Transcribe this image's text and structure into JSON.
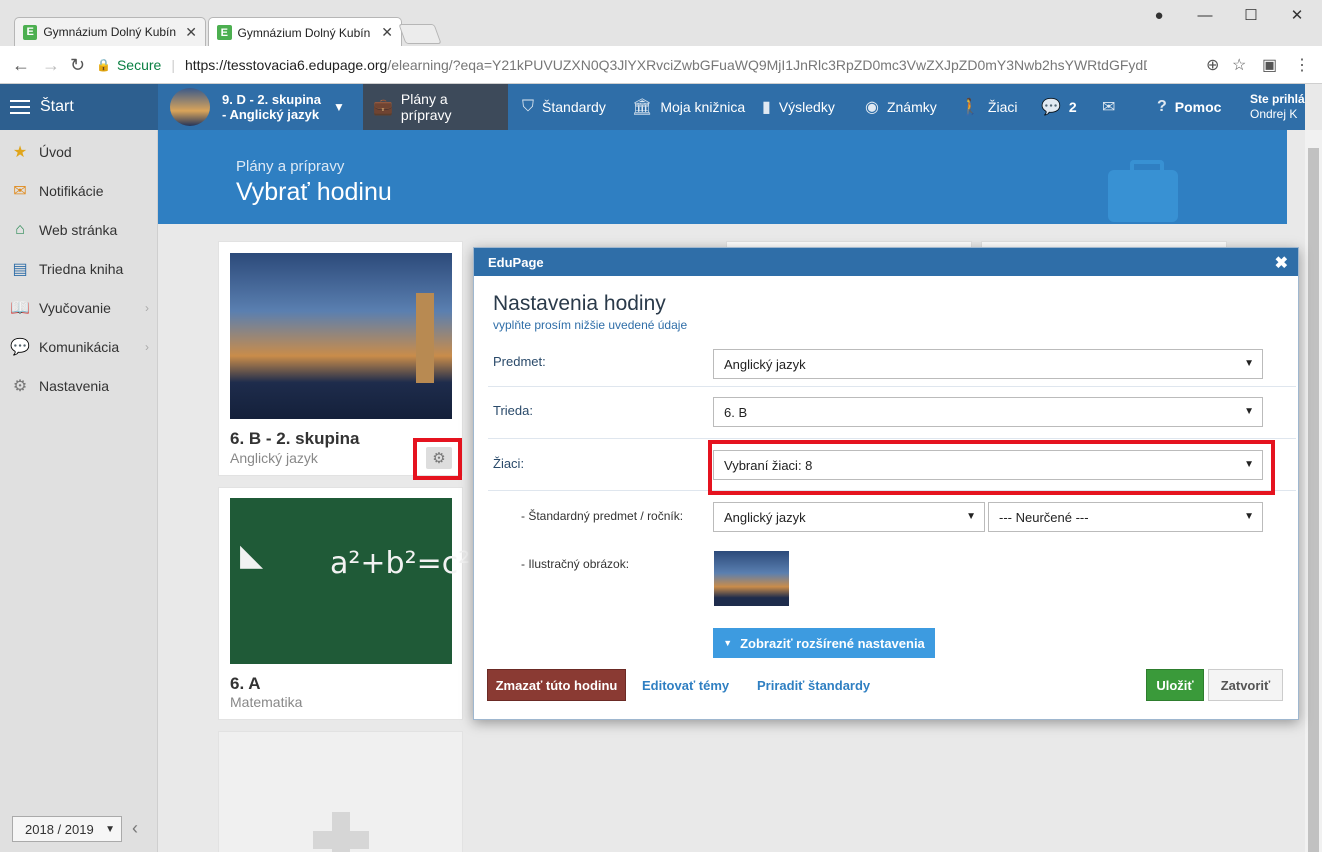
{
  "browser": {
    "tabs": [
      {
        "title": "Gymnázium Dolný Kubín",
        "favicon": "E"
      },
      {
        "title": "Gymnázium Dolný Kubín",
        "favicon": "E"
      }
    ],
    "secure_label": "Secure",
    "url_host": "https://tesstovacia6.edupage.org",
    "url_rest": "/elearning/?eqa=Y21kPUVUZXN0Q3JlYXRvciZwbGFuaWQ9MjI1JnRlc3RpZD0mc3VwZXJpZD0mY3Nwb2hsYWRtdGFydD1jbGFzc1B..."
  },
  "header": {
    "start_label": "Štart",
    "class_line1": "9. D - 2. skupina",
    "class_line2": "- Anglický jazyk",
    "nav": {
      "plans": "Plány a prípravy",
      "standards": "Štandardy",
      "library": "Moja knižnica",
      "results": "Výsledky",
      "grades": "Známky",
      "students": "Žiaci",
      "messages_count": "2",
      "help": "Pomoc"
    },
    "user_line1": "Ste prihlá",
    "user_line2": "Ondrej K"
  },
  "sidebar": {
    "items": [
      {
        "label": "Úvod",
        "icon": "star-icon",
        "color": "#e0a51b"
      },
      {
        "label": "Notifikácie",
        "icon": "envelope-icon",
        "color": "#e08a1b"
      },
      {
        "label": "Web stránka",
        "icon": "home-icon",
        "color": "#2e8b57"
      },
      {
        "label": "Triedna kniha",
        "icon": "book-icon",
        "color": "#2f6ea8"
      },
      {
        "label": "Vyučovanie",
        "icon": "open-book-icon",
        "color": "#2f6ea8"
      },
      {
        "label": "Komunikácia",
        "icon": "chat-icon",
        "color": "#c0392b"
      },
      {
        "label": "Nastavenia",
        "icon": "gear-icon",
        "color": "#777777"
      }
    ],
    "year": "2018 / 2019"
  },
  "banner": {
    "subtitle": "Plány a prípravy",
    "title": "Vybrať hodinu"
  },
  "cards": [
    {
      "title": "6. B - 2. skupina",
      "subtitle": "Anglický jazyk"
    },
    {
      "title": "6. A",
      "subtitle": "Matematika"
    }
  ],
  "dialog": {
    "header": "EduPage",
    "title": "Nastavenia hodiny",
    "subtitle": "vyplňte prosím nižšie uvedené údaje",
    "fields": {
      "subject_label": "Predmet:",
      "subject_value": "Anglický jazyk",
      "class_label": "Trieda:",
      "class_value": "6. B",
      "students_label": "Žiaci:",
      "students_value": "Vybraní žiaci: 8",
      "standard_label": "- Štandardný predmet / ročník:",
      "standard_subject": "Anglický jazyk",
      "standard_grade": "--- Neurčené ---",
      "image_label": "- Ilustračný obrázok:"
    },
    "advanced_button": "Zobraziť rozšírené nastavenia",
    "delete_button": "Zmazať túto hodinu",
    "edit_topics_link": "Editovať témy",
    "assign_standards_link": "Priradiť štandardy",
    "save_button": "Uložiť",
    "close_button": "Zatvoriť"
  },
  "colors": {
    "header_blue": "#2f6ea8",
    "banner_blue": "#2f7fc2",
    "highlight_red": "#e5131f",
    "save_green": "#3a9a3a",
    "delete_brown": "#8a3a33"
  }
}
